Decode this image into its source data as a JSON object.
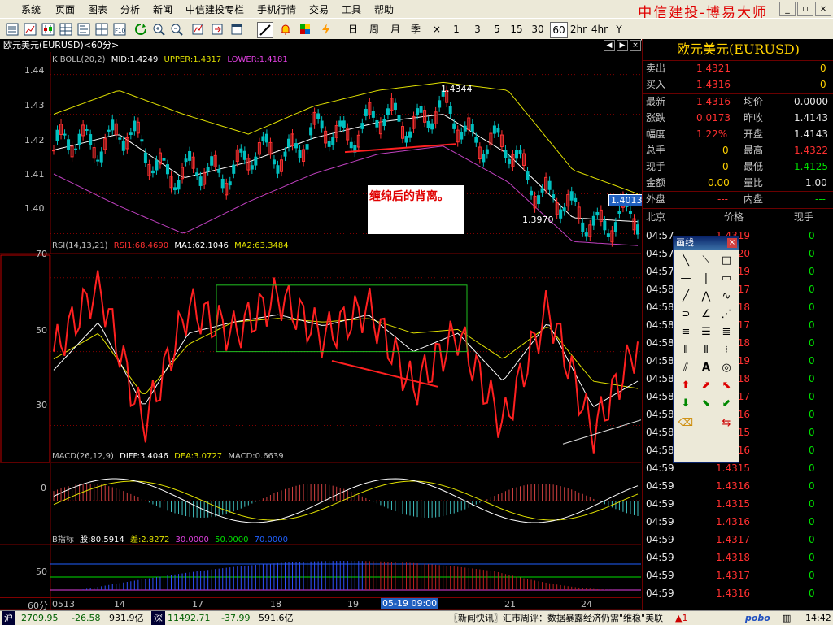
{
  "menu": {
    "items": [
      "系统",
      "页面",
      "图表",
      "分析",
      "新闻",
      "中信建投专栏",
      "手机行情",
      "交易",
      "工具",
      "帮助"
    ],
    "brand": "中信建投-博易大师"
  },
  "toolbar": {
    "periods": [
      "日",
      "周",
      "月",
      "季",
      "×",
      "1",
      "3",
      "5",
      "15",
      "30",
      "60",
      "2hr",
      "4hr",
      "Y"
    ],
    "selected_period": "60"
  },
  "chart_title": "欧元美元(EURUSD)<60分>",
  "colors": {
    "up": "#ff3030",
    "down": "#00c0c0",
    "mid": "#ffffff",
    "upper": "#e0e000",
    "lower": "#c040c0",
    "rsi": "#ff2020",
    "ma1": "#ffffff",
    "ma2": "#e0e000",
    "grid": "#800000"
  },
  "panels": {
    "boll": {
      "label": "K  BOLL(20,2)",
      "mid_label": "MID:1.4249",
      "upper_label": "UPPER:1.4317",
      "lower_label": "LOWER:1.4181",
      "ticks": [
        "1.44",
        "1.43",
        "1.42",
        "1.41",
        "1.40"
      ],
      "high_mark": "1.4344",
      "low_mark": "1.3970",
      "last_price": "1.4013",
      "annotation": "缠绵后的背离。"
    },
    "rsi": {
      "label": "RSI(14,13,21)",
      "rsi1_label": "RSI1:68.4690",
      "ma1_label": "MA1:62.1046",
      "ma2_label": "MA2:63.3484",
      "ticks": [
        "70",
        "50",
        "30"
      ]
    },
    "macd": {
      "label": "MACD(26,12,9)",
      "diff_label": "DIFF:3.4046",
      "dea_label": "DEA:3.0727",
      "macd_label": "MACD:0.6639",
      "ticks": [
        "0"
      ]
    },
    "b": {
      "label": "B指标",
      "gu_label": "股:80.5914",
      "cha_label": "差:2.8272",
      "l30": "30.0000",
      "l50": "50.0000",
      "l70": "70.0000",
      "ticks": [
        "50"
      ]
    }
  },
  "xaxis": {
    "period_label": "60分",
    "labels": [
      "0513",
      "14",
      "17",
      "18",
      "19",
      "21",
      "24"
    ],
    "cursor_label": "05-19 09:00"
  },
  "quote": {
    "title": "欧元美元(EURUSD)",
    "sell_label": "卖出",
    "sell": "1.4321",
    "sell_vol": "0",
    "buy_label": "买入",
    "buy": "1.4316",
    "buy_vol": "0",
    "latest_label": "最新",
    "latest": "1.4316",
    "avg_label": "均价",
    "avg": "0.0000",
    "change_label": "涨跌",
    "change": "0.0173",
    "prev_label": "昨收",
    "prev": "1.4143",
    "pct_label": "幅度",
    "pct": "1.22%",
    "open_label": "开盘",
    "open": "1.4143",
    "vol_label": "总手",
    "vol": "0",
    "high_label": "最高",
    "high": "1.4322",
    "cur_label": "现手",
    "cur": "0",
    "low_label": "最低",
    "low": "1.4125",
    "amt_label": "金额",
    "amt": "0.00",
    "ratio_label": "量比",
    "ratio": "1.00",
    "outer_label": "外盘",
    "outer": "---",
    "inner_label": "内盘",
    "inner": "---"
  },
  "ticks_table": {
    "h_time": "北京",
    "h_price": "价格",
    "h_vol": "现手",
    "rows": [
      {
        "t": "04:57",
        "p": "1.4319",
        "v": "0"
      },
      {
        "t": "04:57",
        "p": "1.4320",
        "v": "0"
      },
      {
        "t": "04:57",
        "p": "1.4319",
        "v": "0"
      },
      {
        "t": "04:58",
        "p": "1.4317",
        "v": "0"
      },
      {
        "t": "04:58",
        "p": "1.4318",
        "v": "0"
      },
      {
        "t": "04:58",
        "p": "1.4317",
        "v": "0"
      },
      {
        "t": "04:58",
        "p": "1.4318",
        "v": "0"
      },
      {
        "t": "04:58",
        "p": "1.4319",
        "v": "0"
      },
      {
        "t": "04:58",
        "p": "1.4318",
        "v": "0"
      },
      {
        "t": "04:58",
        "p": "1.4317",
        "v": "0"
      },
      {
        "t": "04:58",
        "p": "1.4316",
        "v": "0"
      },
      {
        "t": "04:58",
        "p": "1.4315",
        "v": "0"
      },
      {
        "t": "04:58",
        "p": "1.4316",
        "v": "0"
      },
      {
        "t": "04:59",
        "p": "1.4315",
        "v": "0"
      },
      {
        "t": "04:59",
        "p": "1.4316",
        "v": "0"
      },
      {
        "t": "04:59",
        "p": "1.4315",
        "v": "0"
      },
      {
        "t": "04:59",
        "p": "1.4316",
        "v": "0"
      },
      {
        "t": "04:59",
        "p": "1.4317",
        "v": "0"
      },
      {
        "t": "04:59",
        "p": "1.4318",
        "v": "0"
      },
      {
        "t": "04:59",
        "p": "1.4317",
        "v": "0"
      },
      {
        "t": "04:59",
        "p": "1.4316",
        "v": "0"
      }
    ]
  },
  "draw_panel": {
    "title": "画线",
    "text_tool": "A"
  },
  "status": {
    "sh_label": "沪",
    "sh": "2709.95",
    "sh_chg": "-26.58",
    "sh_amt": "931.9亿",
    "sz_label": "深",
    "sz": "11492.71",
    "sz_chg": "-37.99",
    "sz_amt": "591.6亿",
    "news": "〖新闻快讯〗汇市周评：数据暴露经济仍需\"维稳\"美联",
    "logo": "pobo",
    "time": "14:42"
  },
  "chart_data": {
    "type": "line",
    "symbol": "欧元美元(EURUSD)",
    "period": "60分",
    "x": [
      "0513",
      "14",
      "17",
      "18",
      "19",
      "21",
      "24"
    ],
    "price_ylim": [
      1.395,
      1.444
    ],
    "rsi_ylim": [
      20,
      75
    ],
    "series": [
      {
        "name": "MID",
        "values": [
          1.421,
          1.425,
          1.414,
          1.418,
          1.424,
          1.428,
          1.43,
          1.42,
          1.404,
          1.403
        ]
      },
      {
        "name": "UPPER",
        "values": [
          1.43,
          1.436,
          1.43,
          1.425,
          1.432,
          1.436,
          1.438,
          1.436,
          1.416,
          1.41
        ]
      },
      {
        "name": "LOWER",
        "values": [
          1.415,
          1.407,
          1.4,
          1.408,
          1.415,
          1.42,
          1.422,
          1.413,
          1.398,
          1.397
        ]
      },
      {
        "name": "RSI1",
        "values": [
          50,
          68,
          30,
          62,
          55,
          65,
          54,
          62,
          40,
          55,
          30,
          62,
          28,
          52
        ]
      },
      {
        "name": "MA1",
        "values": [
          45,
          58,
          35,
          55,
          58,
          60,
          57,
          60,
          50,
          55,
          42,
          58,
          35,
          42
        ]
      },
      {
        "name": "MA2",
        "values": [
          48,
          55,
          38,
          52,
          58,
          59,
          58,
          59,
          55,
          56,
          48,
          57,
          42,
          40
        ]
      }
    ],
    "annotations": [
      "1.4344",
      "1.3970",
      "1.4013",
      "缠绵后的背离。"
    ]
  }
}
